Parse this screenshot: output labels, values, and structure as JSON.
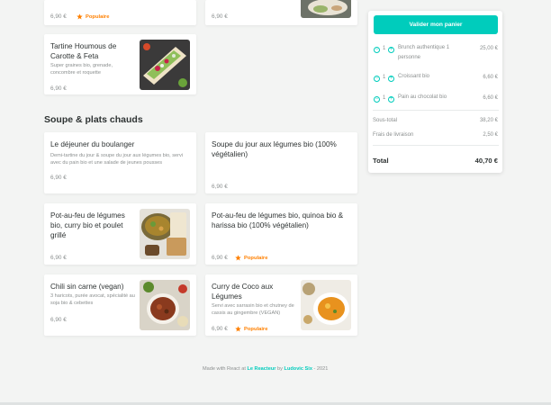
{
  "top_row": {
    "left_price": "6,90 €",
    "left_badge": "Populaire",
    "right_price": "6,90 €"
  },
  "card_houmous": {
    "title": "Tartine Houmous de Carotte & Feta",
    "description": "Super graines bio, grenade, concombre et roquette",
    "price": "6,90 €"
  },
  "section": {
    "title": "Soupe & plats chauds"
  },
  "menu_items": [
    {
      "title": "Le déjeuner du boulanger",
      "description": "Demi-tartine du jour & soupe du jour aux légumes bio, servi avec du pain bio et une salade de jeunes pousses",
      "price": "6,90 €"
    },
    {
      "title": "Soupe du jour aux légumes bio (100% végétalien)",
      "price": "6,90 €"
    },
    {
      "title": "Pot-au-feu de légumes bio, curry bio et poulet grillé",
      "price": "6,90 €"
    },
    {
      "title": "Pot-au-feu de légumes bio, quinoa bio & harissa bio (100% végétalien)",
      "price": "6,90 €",
      "badge": "Populaire"
    },
    {
      "title": "Chili sin carne (vegan)",
      "description": "3 haricots, purée avocat, spécialité au soja bio & cebettes",
      "price": "6,90 €"
    },
    {
      "title": "Curry de Coco aux Légumes",
      "description": "Servi avec sarrasin bio et chutney de cassis au gingembre (VEGAN)",
      "price": "6,90 €",
      "badge": "Populaire"
    }
  ],
  "cart": {
    "validate_label": "Valider mon panier",
    "items": [
      {
        "qty": "1",
        "name": "Brunch authentique 1 personne",
        "price": "25,00 €"
      },
      {
        "qty": "1",
        "name": "Croissant bio",
        "price": "6,60 €"
      },
      {
        "qty": "1",
        "name": "Pain au chocolat bio",
        "price": "6,60 €"
      }
    ],
    "subtotal_label": "Sous-total",
    "subtotal_value": "38,20 €",
    "delivery_label": "Frais de livraison",
    "delivery_value": "2,50 €",
    "total_label": "Total",
    "total_value": "40,70 €",
    "minus": "−",
    "plus": "+"
  },
  "footer": {
    "made_with": "Made with React at",
    "school": "Le Reacteur",
    "by": "by",
    "author": "Ludovic Six",
    "year": "- 2021"
  },
  "colors": {
    "accent": "#00ccbc",
    "popular": "#ff8000",
    "background": "#f3f4f3"
  },
  "icons": {
    "star": "star-icon",
    "minus": "minus-circle-icon",
    "plus": "plus-circle-icon"
  }
}
